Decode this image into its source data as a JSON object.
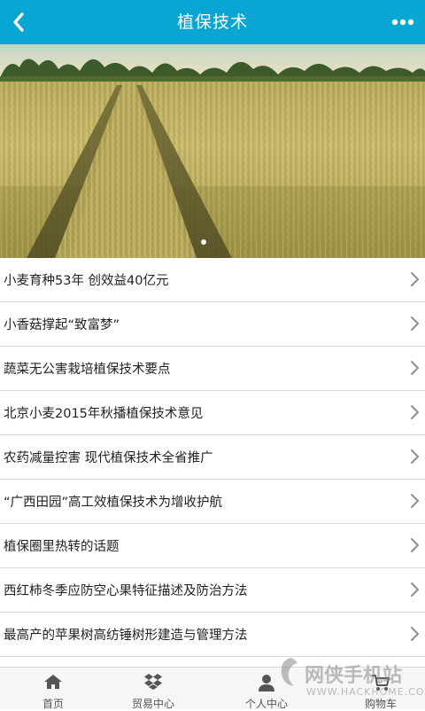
{
  "header": {
    "title": "植保技术",
    "back_icon": "chevron-left-icon",
    "more_icon": "more-dots-icon",
    "background": "#0aa6d3"
  },
  "banner": {
    "image": "wheat-field-photo",
    "active_slide": 1
  },
  "articles": [
    {
      "title": "小麦育种53年 创效益40亿元"
    },
    {
      "title": "小香菇撑起“致富梦”"
    },
    {
      "title": "蔬菜无公害栽培植保技术要点"
    },
    {
      "title": "北京小麦2015年秋播植保技术意见"
    },
    {
      "title": "农药减量控害 现代植保技术全省推广"
    },
    {
      "title": "“广西田园”高工效植保技术为增收护航"
    },
    {
      "title": "植保圈里热转的话题"
    },
    {
      "title": "西红柿冬季应防空心果特征描述及防治方法"
    },
    {
      "title": "最高产的苹果树高纺锤树形建造与管理方法"
    }
  ],
  "tabbar": [
    {
      "label": "首页",
      "icon": "home-icon"
    },
    {
      "label": "贸易中心",
      "icon": "dropbox-icon"
    },
    {
      "label": "个人中心",
      "icon": "user-icon"
    },
    {
      "label": "购物车",
      "icon": "cart-icon"
    }
  ],
  "watermark": {
    "text": "网侠手机站",
    "url": "WWW.HACKHOME.COM"
  }
}
